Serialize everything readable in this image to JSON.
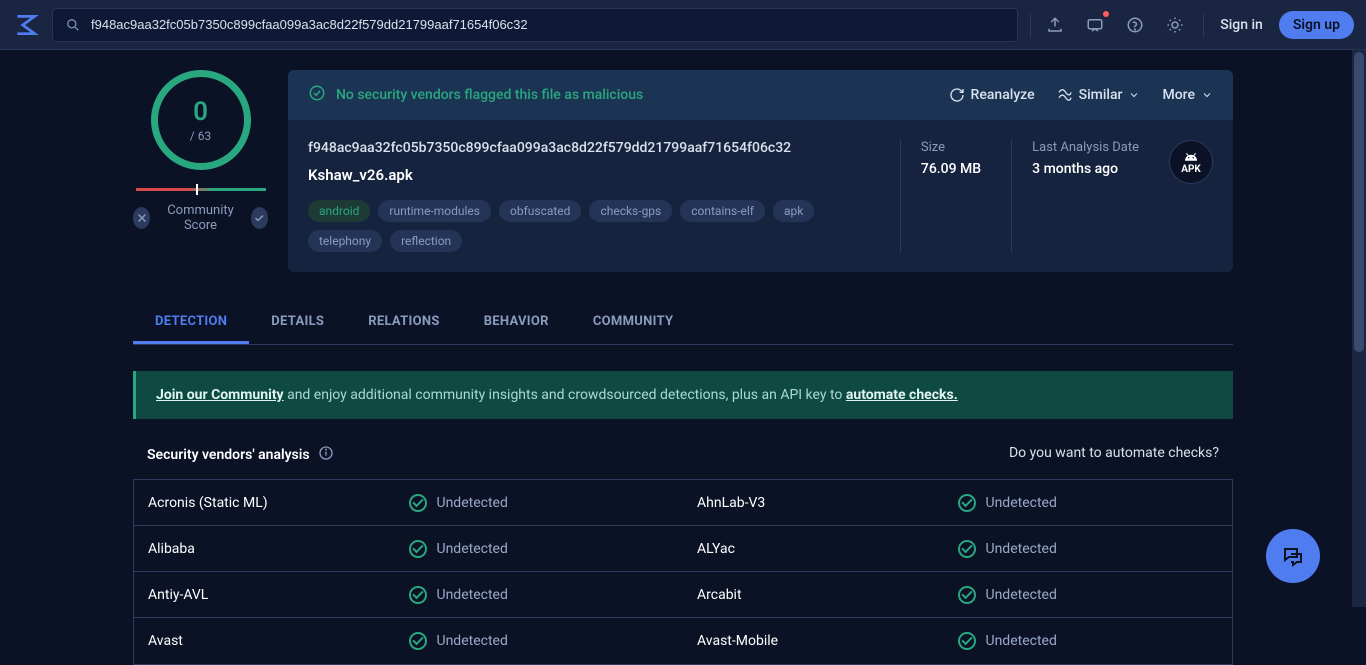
{
  "header": {
    "search_value": "f948ac9aa32fc05b7350c899cfaa099a3ac8d22f579dd21799aaf71654f06c32",
    "sign_in": "Sign in",
    "sign_up": "Sign up"
  },
  "score": {
    "detections": "0",
    "total": "/ 63",
    "community_label": "Community Score"
  },
  "banner": {
    "message": "No security vendors flagged this file as malicious",
    "reanalyze": "Reanalyze",
    "similar": "Similar",
    "more": "More"
  },
  "file": {
    "hash": "f948ac9aa32fc05b7350c899cfaa099a3ac8d22f579dd21799aaf71654f06c32",
    "name": "Kshaw_v26.apk",
    "size_label": "Size",
    "size_value": "76.09 MB",
    "date_label": "Last Analysis Date",
    "date_value": "3 months ago",
    "type_badge": "APK",
    "tags": [
      "android",
      "runtime-modules",
      "obfuscated",
      "checks-gps",
      "contains-elf",
      "apk",
      "telephony",
      "reflection"
    ]
  },
  "tabs": [
    "DETECTION",
    "DETAILS",
    "RELATIONS",
    "BEHAVIOR",
    "COMMUNITY"
  ],
  "promo": {
    "link1": "Join our Community",
    "mid": " and enjoy additional community insights and crowdsourced detections, plus an API key to ",
    "link2": "automate checks."
  },
  "section": {
    "title": "Security vendors' analysis",
    "right": "Do you want to automate checks?"
  },
  "vendors": [
    {
      "l": "Acronis (Static ML)",
      "lr": "Undetected",
      "r": "AhnLab-V3",
      "rr": "Undetected"
    },
    {
      "l": "Alibaba",
      "lr": "Undetected",
      "r": "ALYac",
      "rr": "Undetected"
    },
    {
      "l": "Antiy-AVL",
      "lr": "Undetected",
      "r": "Arcabit",
      "rr": "Undetected"
    },
    {
      "l": "Avast",
      "lr": "Undetected",
      "r": "Avast-Mobile",
      "rr": "Undetected"
    }
  ]
}
